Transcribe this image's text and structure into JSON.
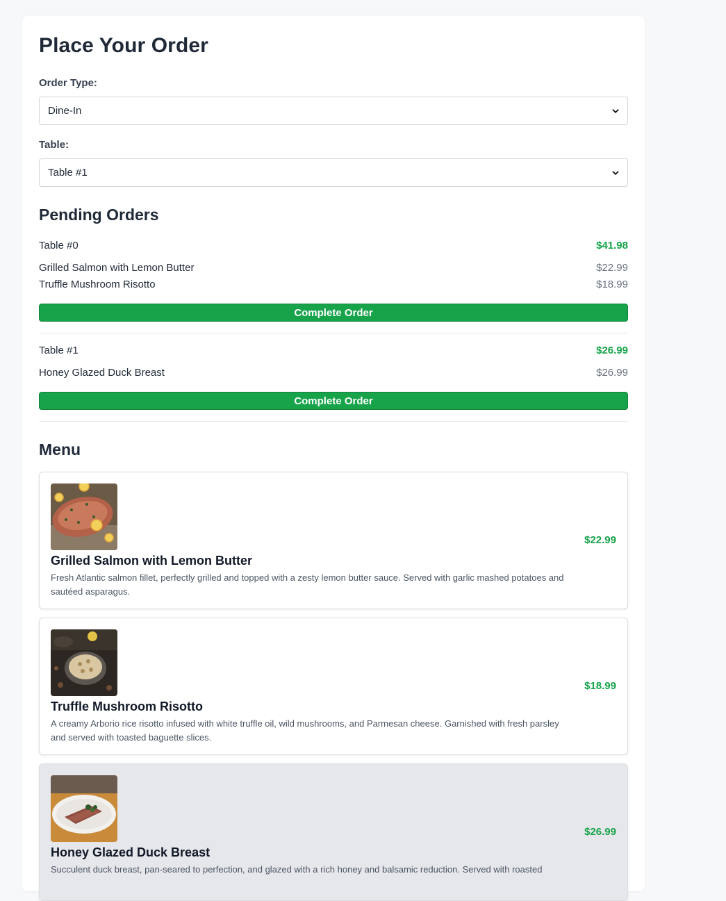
{
  "page_title": "Place Your Order",
  "order_type": {
    "label": "Order Type:",
    "value": "Dine-In"
  },
  "table_select": {
    "label": "Table:",
    "value": "Table #1"
  },
  "pending": {
    "heading": "Pending Orders",
    "orders": [
      {
        "table": "Table #0",
        "total": "$41.98",
        "items": [
          {
            "name": "Grilled Salmon with Lemon Butter",
            "price": "$22.99"
          },
          {
            "name": "Truffle Mushroom Risotto",
            "price": "$18.99"
          }
        ],
        "button": "Complete Order"
      },
      {
        "table": "Table #1",
        "total": "$26.99",
        "items": [
          {
            "name": "Honey Glazed Duck Breast",
            "price": "$26.99"
          }
        ],
        "button": "Complete Order"
      }
    ]
  },
  "menu": {
    "heading": "Menu",
    "items": [
      {
        "name": "Grilled Salmon with Lemon Butter",
        "description": "Fresh Atlantic salmon fillet, perfectly grilled and topped with a zesty lemon butter sauce. Served with garlic mashed potatoes and sautéed asparagus.",
        "price": "$22.99",
        "image_icon": "salmon-photo"
      },
      {
        "name": "Truffle Mushroom Risotto",
        "description": "A creamy Arborio rice risotto infused with white truffle oil, wild mushrooms, and Parmesan cheese. Garnished with fresh parsley and served with toasted baguette slices.",
        "price": "$18.99",
        "image_icon": "risotto-photo"
      },
      {
        "name": "Honey Glazed Duck Breast",
        "description": "Succulent duck breast, pan-seared to perfection, and glazed with a rich honey and balsamic reduction. Served with roasted",
        "price": "$26.99",
        "image_icon": "duck-photo",
        "selected": true
      }
    ]
  },
  "colors": {
    "accent_green": "#16a34a",
    "selected_card_bg": "#e6e7eb"
  }
}
